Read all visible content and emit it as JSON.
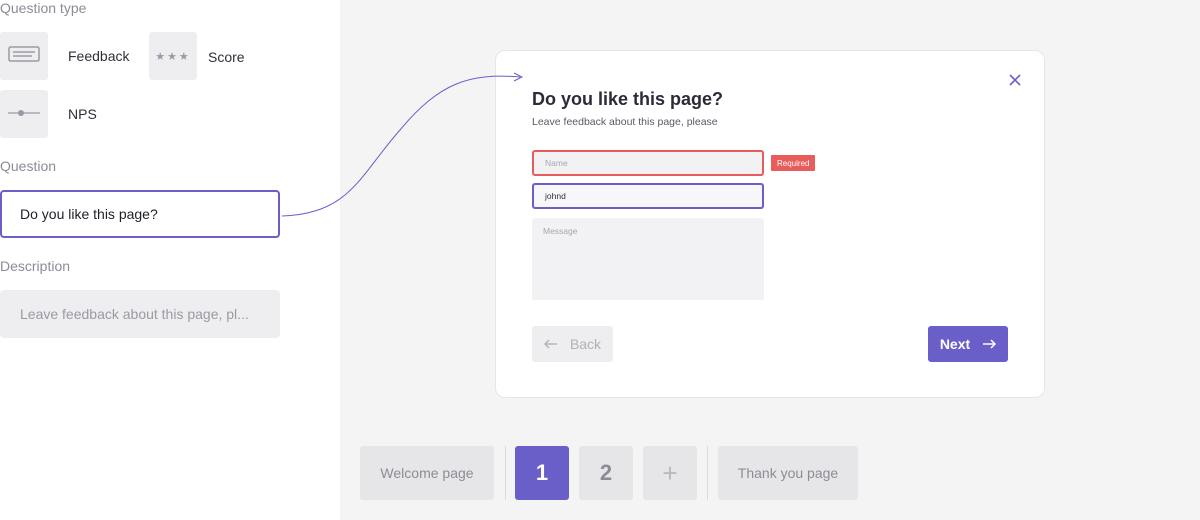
{
  "sidebar": {
    "question_type_label": "Question type",
    "types": [
      {
        "label": "Feedback",
        "icon": "feedback-icon"
      },
      {
        "label": "Score",
        "icon": "stars-icon"
      },
      {
        "label": "NPS",
        "icon": "slider-icon"
      }
    ],
    "question_label": "Question",
    "question_value": "Do you like this page?",
    "description_label": "Description",
    "description_value": "Leave feedback about this page, pl..."
  },
  "preview": {
    "title": "Do you like this page?",
    "subtitle": "Leave feedback about this page, please",
    "name_placeholder": "Name",
    "required_label": "Required",
    "username_value": "johnd",
    "message_placeholder": "Message",
    "back_label": "Back",
    "next_label": "Next"
  },
  "pages": {
    "welcome": "Welcome page",
    "page1": "1",
    "page2": "2",
    "add": "+",
    "thanks": "Thank you page"
  },
  "colors": {
    "accent": "#6a5fc8",
    "error": "#e85c5c",
    "panel_bg": "#f4f4f5"
  }
}
